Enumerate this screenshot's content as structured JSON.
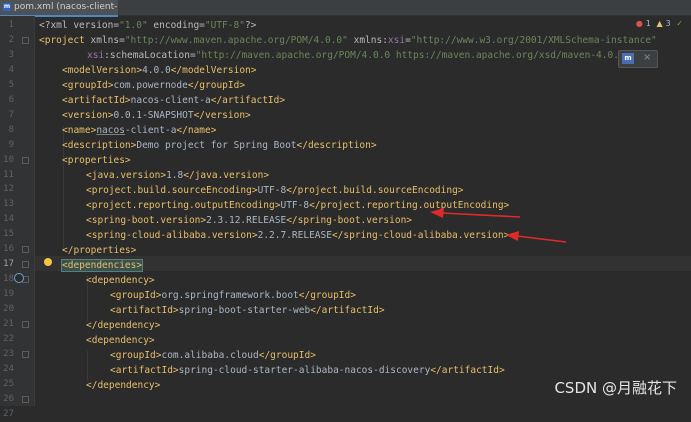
{
  "tab": {
    "label": "pom.xml (nacos-client-a)",
    "icon": "maven-file-icon"
  },
  "inspections": {
    "errors": "1",
    "warnings": "3",
    "ok": "✓"
  },
  "maven_popup": {
    "icon": "maven-reload-icon",
    "icon_text": "m",
    "close": "×"
  },
  "watermark": "CSDN @月融花下",
  "annotation": {
    "arrow_color": "#e02a2a"
  },
  "current_line": 17,
  "line_numbers": [
    "1",
    "2",
    "3",
    "4",
    "5",
    "6",
    "7",
    "8",
    "9",
    "10",
    "11",
    "12",
    "13",
    "14",
    "15",
    "16",
    "17",
    "18",
    "19",
    "20",
    "21",
    "22",
    "23",
    "24",
    "25",
    "26",
    "27"
  ]
}
